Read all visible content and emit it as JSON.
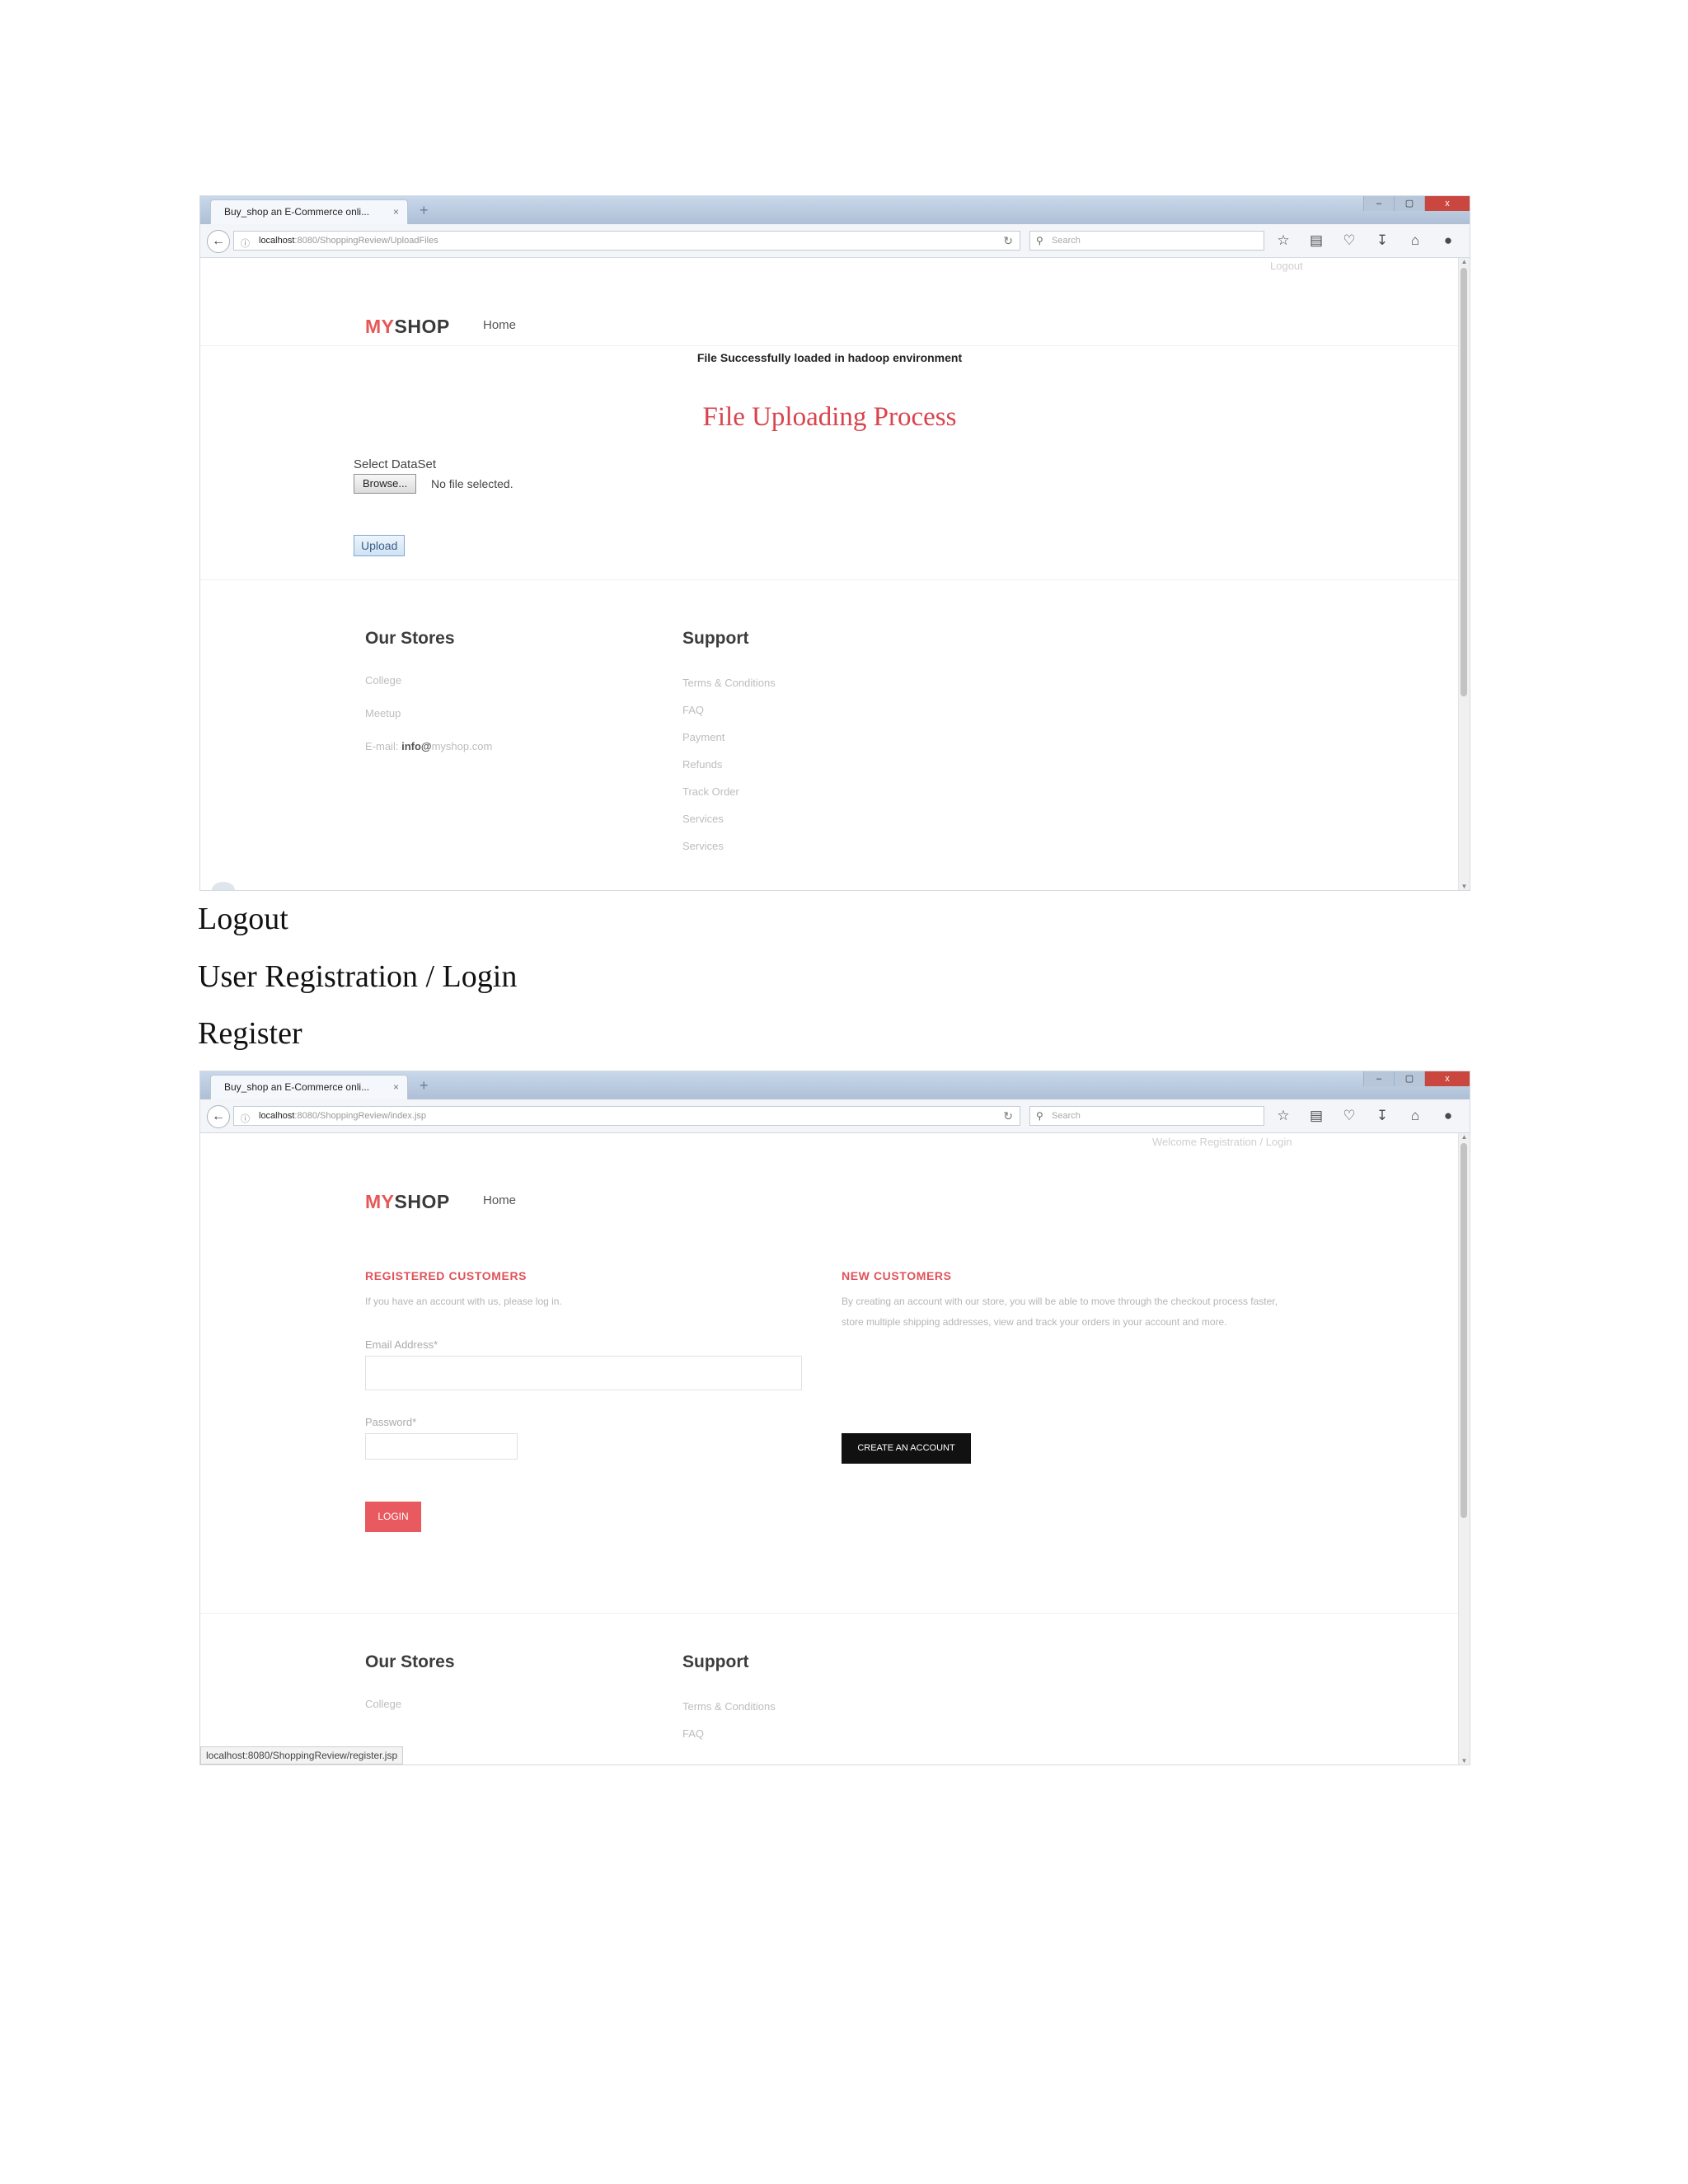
{
  "screenshot1": {
    "browser": {
      "tab_title": "Buy_shop an E-Commerce onli...",
      "tab_close": "×",
      "new_tab": "+",
      "window_min": "–",
      "window_max": "▢",
      "window_close": "x",
      "url_host": "localhost",
      "url_path": ":8080/ShoppingReview/UploadFiles",
      "search_placeholder": "Search",
      "scroll_position": 0.15
    },
    "header": {
      "top_link": "Logout",
      "logo_my": "MY",
      "logo_shop": "SHOP",
      "nav_home": "Home"
    },
    "main": {
      "success_message": "File Successfully loaded in hadoop environment",
      "title": "File Uploading Process",
      "dataset_label": "Select DataSet",
      "browse_label": "Browse...",
      "no_file_text": "No file selected.",
      "upload_label": "Upload"
    },
    "footer": {
      "stores_heading": "Our Stores",
      "stores_links": [
        "College",
        "Meetup"
      ],
      "email_label": "E-mail:",
      "email_user": "info@",
      "email_domain": "myshop.com",
      "support_heading": "Support",
      "support_links": [
        "Terms & Conditions",
        "FAQ",
        "Payment",
        "Refunds",
        "Track Order",
        "Services",
        "Services"
      ]
    }
  },
  "document_text": {
    "line1": "Logout",
    "line2": "User Registration  / Login",
    "line3": "Register"
  },
  "screenshot2": {
    "browser": {
      "tab_title": "Buy_shop an E-Commerce onli...",
      "tab_close": "×",
      "new_tab": "+",
      "window_min": "–",
      "window_max": "▢",
      "window_close": "x",
      "url_host": "localhost",
      "url_path": ":8080/ShoppingReview/index.jsp",
      "search_placeholder": "Search",
      "scroll_position": 0.05
    },
    "header": {
      "top_link": "Welcome Registration / Login",
      "logo_my": "MY",
      "logo_shop": "SHOP",
      "nav_home": "Home"
    },
    "registered": {
      "heading": "REGISTERED CUSTOMERS",
      "intro": "If you have an account with us, please log in.",
      "email_label": "Email Address*",
      "password_label": "Password*",
      "login_label": "LOGIN"
    },
    "new_customers": {
      "heading": "NEW CUSTOMERS",
      "intro": "By creating an account with our store, you will be able to move through the checkout process faster, store multiple shipping addresses, view and track your orders in your account and more.",
      "create_label": "CREATE AN ACCOUNT"
    },
    "footer": {
      "stores_heading": "Our Stores",
      "stores_links": [
        "College"
      ],
      "support_heading": "Support",
      "support_links": [
        "Terms & Conditions",
        "FAQ"
      ]
    },
    "status_url": "localhost:8080/ShoppingReview/register.jsp"
  },
  "icons": {
    "back": "back-arrow-icon",
    "info": "info-icon",
    "reload": "reload-icon",
    "search": "search-icon",
    "toolbar": [
      "bookmark-star-icon",
      "clipboard-icon",
      "pocket-icon",
      "download-icon",
      "home-icon",
      "sync-icon",
      "menu-icon"
    ]
  }
}
